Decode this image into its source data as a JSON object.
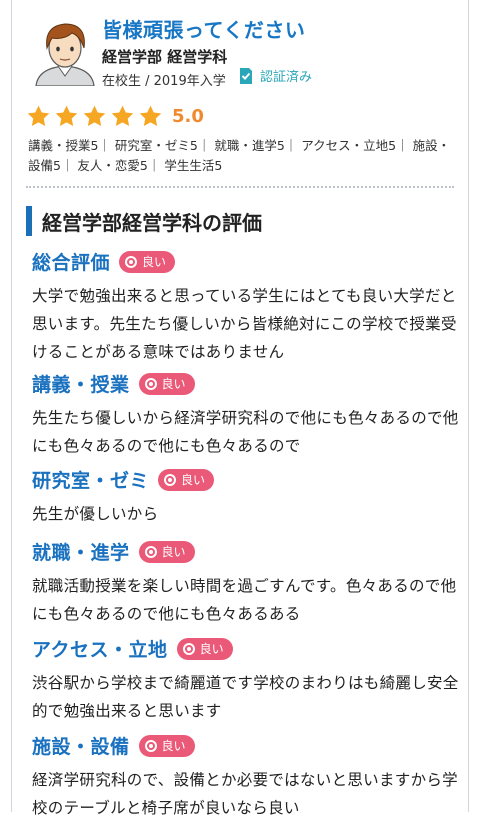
{
  "author": {
    "title": "皆様頑張ってください",
    "department": "経営学部 経営学科",
    "status": "在校生 / 2019年入学",
    "verified": "認証済み"
  },
  "rating": {
    "value": "5.0",
    "stars": 5
  },
  "categories_text": "講義・授業5｜ 研究室・ゼミ5｜ 就職・進学5｜ アクセス・立地5｜ 施設・設備5｜ 友人・恋愛5｜ 学生生活5",
  "section_title": "経営学部経営学科の評価",
  "badge_label": "良い",
  "reviews": [
    {
      "title": "総合評価",
      "badge": "良い",
      "body": "大学で勉強出来ると思っている学生にはとても良い大学だと思います。先生たち優しいから皆様絶対にこの学校で授業受けることがある意味ではありません"
    },
    {
      "title": "講義・授業",
      "badge": "良い",
      "body": "先生たち優しいから経済学研究科ので他にも色々あるので他にも色々あるので他にも色々あるので"
    },
    {
      "title": "研究室・ゼミ",
      "badge": "良い",
      "body": "先生が優しいから"
    },
    {
      "title": "就職・進学",
      "badge": "良い",
      "body": "就職活動授業を楽しい時間を過ごすんです。色々あるので他にも色々あるので他にも色々あるある"
    },
    {
      "title": "アクセス・立地",
      "badge": "良い",
      "body": "渋谷駅から学校まで綺麗道です学校のまわりはも綺麗し安全的で勉強出来ると思います"
    },
    {
      "title": "施設・設備",
      "badge": "良い",
      "body": "経済学研究科ので、設備とか必要ではないと思いますから学校のテーブルと椅子席が良いなら良い"
    }
  ]
}
